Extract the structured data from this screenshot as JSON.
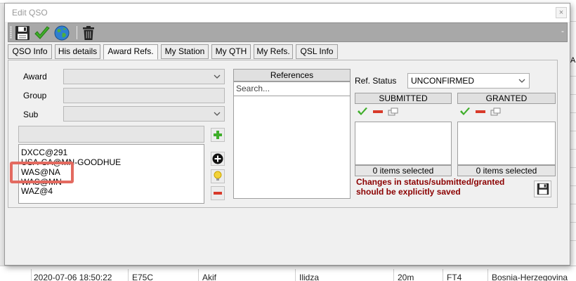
{
  "background": {
    "right_partial": "A",
    "bottom_row": {
      "datetime": "2020-07-06 18:50:22",
      "call": "E75C",
      "name": "Akif",
      "qth": "Ilidza",
      "band": "20m",
      "mode": "FT4",
      "country": "Bosnia-Herzegovina"
    }
  },
  "dialog": {
    "title": "Edit QSO",
    "close": "×",
    "minimize": "-"
  },
  "toolbar": {
    "buttons": [
      "floppy-save-icon",
      "checkmark-icon",
      "globe-icon",
      "trash-icon"
    ]
  },
  "tabs": [
    {
      "label": "QSO Info",
      "active": false
    },
    {
      "label": "His details",
      "active": false
    },
    {
      "label": "Award Refs.",
      "active": true
    },
    {
      "label": "My Station",
      "active": false
    },
    {
      "label": "My QTH",
      "active": false
    },
    {
      "label": "My Refs.",
      "active": false
    },
    {
      "label": "QSL Info",
      "active": false
    }
  ],
  "award_refs": {
    "award_label": "Award",
    "group_label": "Group",
    "sub_label": "Sub",
    "award_value": "",
    "group_value": "",
    "sub_value": "",
    "list_items": [
      "DXCC@291",
      "USA-CA@MN-GOODHUE",
      "WAS@NA",
      "WAS@MN",
      "WAZ@4"
    ],
    "highlighted_item": "WAS@MN"
  },
  "references": {
    "header": "References",
    "search_placeholder": "Search..."
  },
  "status": {
    "label": "Ref. Status",
    "value": "UNCONFIRMED",
    "submitted_header": "SUBMITTED",
    "granted_header": "GRANTED",
    "submitted_count": "0 items selected",
    "granted_count": "0 items selected",
    "warning_line1": "Changes in status/submitted/granted",
    "warning_line2": "should be explicitly saved"
  },
  "colors": {
    "accent_green": "#3fae2a",
    "warn_red": "#8b0000",
    "highlight": "#e36a60"
  }
}
